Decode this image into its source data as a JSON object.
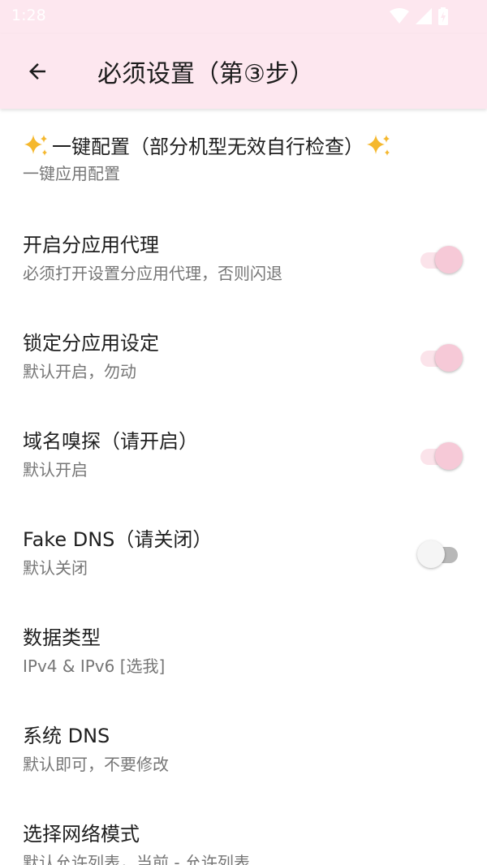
{
  "status_bar": {
    "time": "1:28"
  },
  "app_bar": {
    "title": "必须设置（第③步）"
  },
  "items": [
    {
      "title": "一键配置（部分机型无效自行检查）",
      "summary": "一键应用配置",
      "sparkles": true
    },
    {
      "title": "开启分应用代理",
      "summary": "必须打开设置分应用代理，否则闪退",
      "switch": true,
      "checked": true
    },
    {
      "title": "锁定分应用设定",
      "summary": "默认开启，勿动",
      "switch": true,
      "checked": true
    },
    {
      "title": "域名嗅探（请开启）",
      "summary": "默认开启",
      "switch": true,
      "checked": true
    },
    {
      "title": "Fake DNS（请关闭）",
      "summary": "默认关闭",
      "switch": true,
      "checked": false
    },
    {
      "title": "数据类型",
      "summary": "IPv4 & IPv6 [选我]"
    },
    {
      "title": "系统 DNS",
      "summary": "默认即可，不要修改"
    },
    {
      "title": "选择网络模式",
      "summary": "默认允许列表，当前 - 允许列表"
    }
  ],
  "colors": {
    "app_bar_bg": "#fde7ef",
    "switch_on_thumb": "#f6c9d7",
    "switch_off_track": "#b8b8b8"
  }
}
